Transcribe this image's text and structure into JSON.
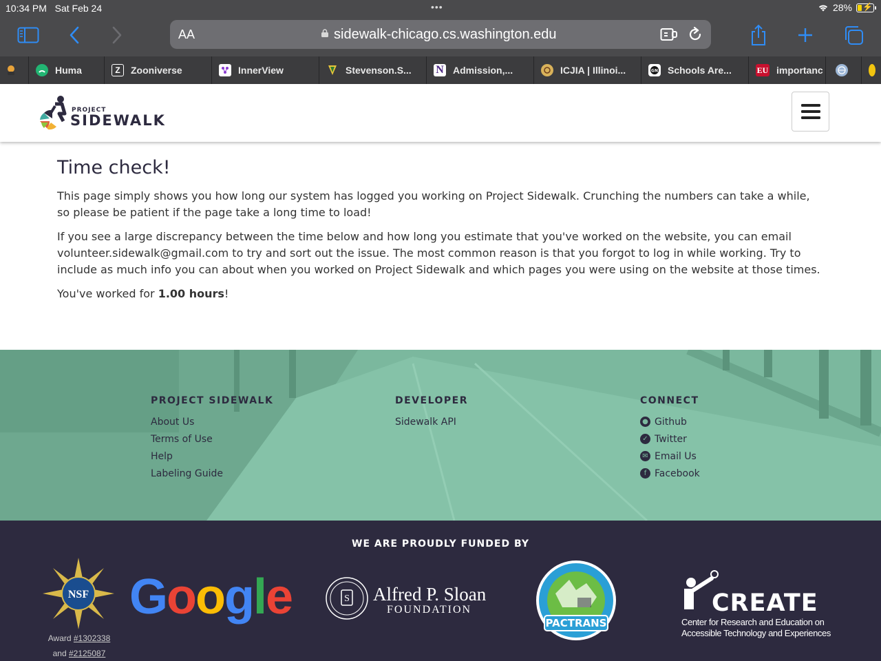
{
  "status": {
    "time": "10:34 PM",
    "date": "Sat Feb 24",
    "battery": "28%",
    "battery_level": 0.28
  },
  "browser": {
    "text_size_label": "AA",
    "url": "sidewalk-chicago.cs.washington.edu",
    "tabs": [
      {
        "label": "Huma",
        "favicon": "leaf-icon",
        "color": "#22b573"
      },
      {
        "label": "Zooniverse",
        "favicon": "zooniverse-icon",
        "color": "#ffffff"
      },
      {
        "label": "InnerView",
        "favicon": "innerview-icon",
        "color": "#ffffff"
      },
      {
        "label": "Stevenson.S...",
        "favicon": "stevenson-icon",
        "color": "#e8c53a"
      },
      {
        "label": "Admission,...",
        "favicon": "northwestern-icon",
        "color": "#ffffff"
      },
      {
        "label": "ICJIA | Illinoi...",
        "favicon": "illinois-seal-icon",
        "color": "#d9b25a"
      },
      {
        "label": "Schools Are...",
        "favicon": "gn-icon",
        "color": "#ffffff"
      },
      {
        "label": "importanc",
        "favicon": "eu-icon",
        "color": "#c8102e"
      }
    ]
  },
  "header": {
    "logo_small": "PROJECT",
    "logo_big": "SIDEWALK"
  },
  "main": {
    "title": "Time check!",
    "para1": "This page simply shows you how long our system has logged you working on Project Sidewalk. Crunching the numbers can take a while, so please be patient if the page take a long time to load!",
    "para2": "If you see a large discrepancy between the time below and how long you estimate that you've worked on the website, you can email volunteer.sidewalk@gmail.com to try and sort out the issue. The most common reason is that you forgot to log in while working. Try to include as much info you can about when you worked on Project Sidewalk and which pages you were using on the website at those times.",
    "worked_prefix": "You've worked for ",
    "worked_value": "1.00 hours",
    "worked_suffix": "!"
  },
  "footer": {
    "col1": {
      "title": "PROJECT SIDEWALK",
      "links": [
        "About Us",
        "Terms of Use",
        "Help",
        "Labeling Guide"
      ]
    },
    "col2": {
      "title": "DEVELOPER",
      "links": [
        "Sidewalk API"
      ]
    },
    "col3": {
      "title": "CONNECT",
      "links": [
        "Github",
        "Twitter",
        "Email Us",
        "Facebook"
      ]
    }
  },
  "funded": {
    "title": "WE ARE PROUDLY FUNDED BY",
    "nsf_logo_text": "NSF",
    "award_prefix": "Award ",
    "award1": "#1302338",
    "award_and": "and ",
    "award2": "#2125087",
    "google": "Google",
    "sloan_name": "Alfred P. Sloan",
    "sloan_sub": "FOUNDATION",
    "pactrans": "PACTRANS",
    "create": "CREATE",
    "create_sub": "Center for Research and Education on Accessible Technology and Experiences"
  },
  "colors": {
    "accent": "#2f8cf5",
    "footer_bg": "#7bb89e",
    "funded_bg": "#2d2a3f",
    "brand_dark": "#2d2a3f"
  }
}
